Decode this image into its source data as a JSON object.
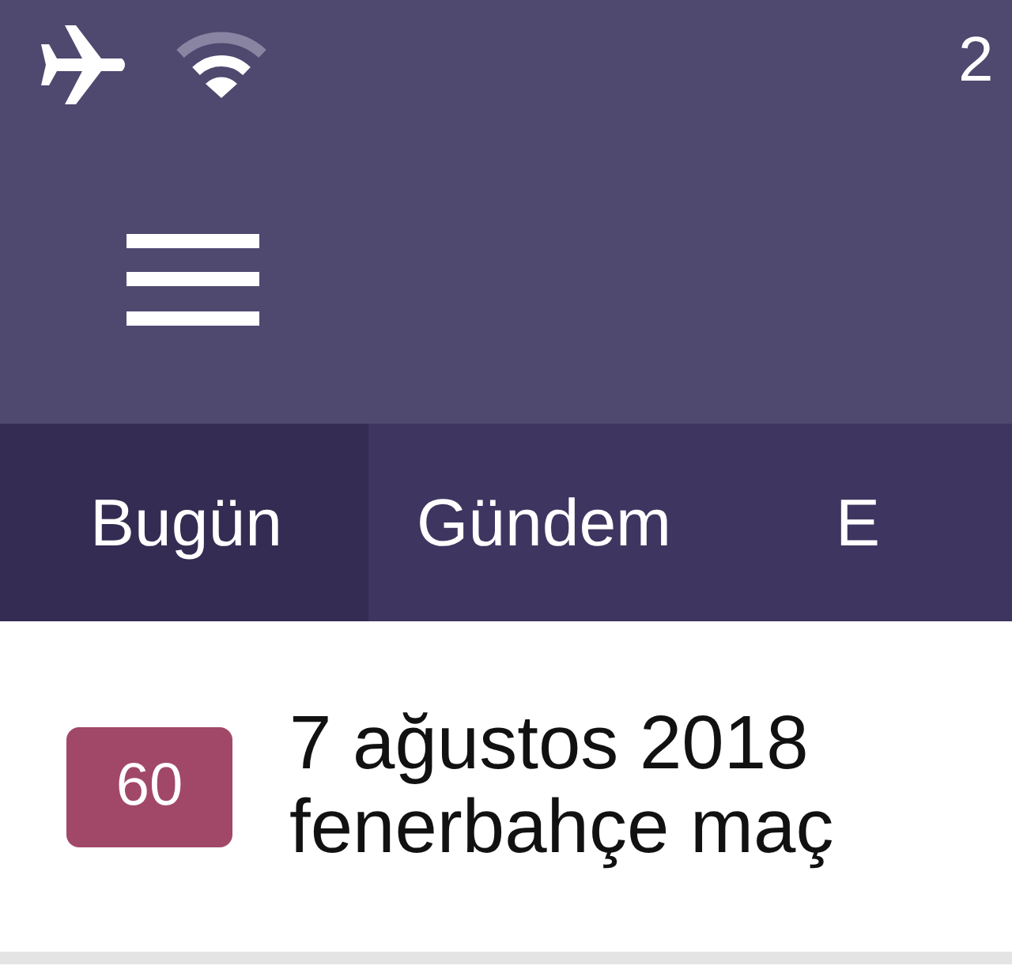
{
  "status_bar": {
    "time": "2"
  },
  "tabs": [
    {
      "label": "Bugün",
      "selected": true
    },
    {
      "label": "Gündem",
      "selected": false
    },
    {
      "label": "E",
      "selected": false
    }
  ],
  "entries": [
    {
      "badge": "60",
      "title_lines": [
        "7 ağustos 2018",
        "fenerbahçe maç"
      ]
    }
  ]
}
